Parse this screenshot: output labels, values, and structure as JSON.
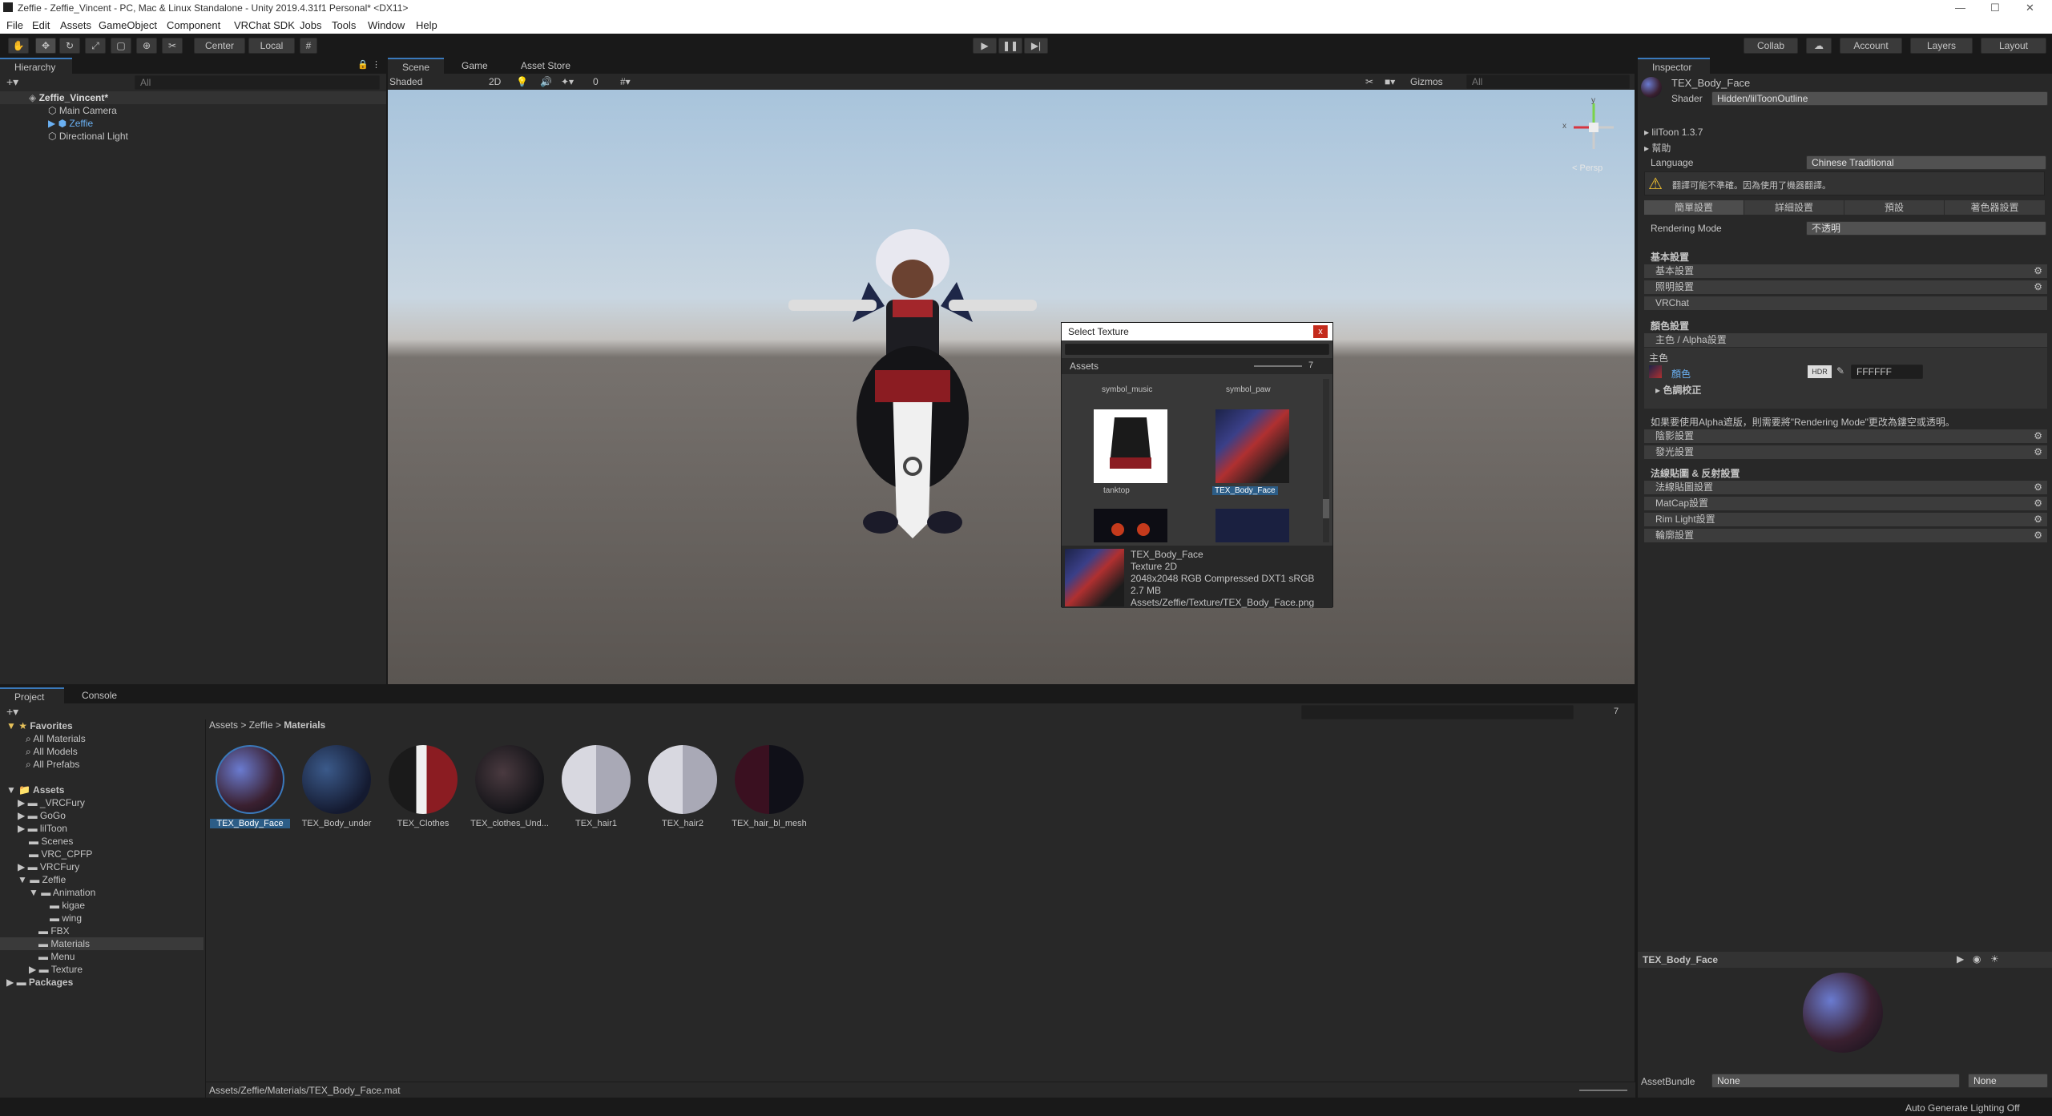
{
  "window": {
    "title": "Zeffie - Zeffie_Vincent - PC, Mac & Linux Standalone - Unity 2019.4.31f1 Personal* <DX11>"
  },
  "menu": [
    "File",
    "Edit",
    "Assets",
    "GameObject",
    "Component",
    "VRChat SDK",
    "Jobs",
    "Tools",
    "Window",
    "Help"
  ],
  "toolbar": {
    "pivot": "Center",
    "space": "Local",
    "collab": "Collab",
    "account": "Account",
    "layers": "Layers",
    "layout": "Layout"
  },
  "hierarchy": {
    "tab": "Hierarchy",
    "search_placeholder": "All",
    "scene": "Zeffie_Vincent*",
    "items": [
      "Main Camera",
      "Zeffie",
      "Directional Light"
    ]
  },
  "scene": {
    "tabs": [
      "Scene",
      "Game",
      "Asset Store"
    ],
    "shading": "Shaded",
    "mode2d": "2D",
    "hidden_count": "0",
    "gizmos": "Gizmos",
    "search_placeholder": "All",
    "persp": "< Persp",
    "axis_x": "x",
    "axis_y": "y"
  },
  "select_texture": {
    "title": "Select Texture",
    "close": "x",
    "tab": "Assets",
    "count": "7",
    "columns": [
      "symbol_music",
      "symbol_paw"
    ],
    "items": [
      "tanktop",
      "TEX_Body_Face"
    ],
    "info": {
      "name": "TEX_Body_Face",
      "type": "Texture 2D",
      "format": "2048x2048  RGB Compressed DXT1 sRGB",
      "size": "2.7 MB",
      "path": "Assets/Zeffie/Texture/TEX_Body_Face.png"
    }
  },
  "project": {
    "tabs": [
      "Project",
      "Console"
    ],
    "count": "7",
    "favorites_label": "Favorites",
    "favorites": [
      "All Materials",
      "All Models",
      "All Prefabs"
    ],
    "assets_label": "Assets",
    "assets": [
      "_VRCFury",
      "GoGo",
      "lilToon",
      "Scenes",
      "VRC_CPFP",
      "VRCFury",
      "Zeffie",
      "Animation",
      "kigae",
      "wing",
      "FBX",
      "Materials",
      "Menu",
      "Texture",
      "Packages"
    ],
    "breadcrumb": [
      "Assets",
      "Zeffie",
      "Materials"
    ],
    "materials": [
      "TEX_Body_Face",
      "TEX_Body_under",
      "TEX_Clothes",
      "TEX_clothes_Und...",
      "TEX_hair1",
      "TEX_hair2",
      "TEX_hair_bl_mesh"
    ],
    "footer_path": "Assets/Zeffie/Materials/TEX_Body_Face.mat"
  },
  "inspector": {
    "tab": "Inspector",
    "material": "TEX_Body_Face",
    "shader_label": "Shader",
    "shader": "Hidden/lilToonOutline",
    "version": "lilToon 1.3.7",
    "help": "幫助",
    "language_label": "Language",
    "language": "Chinese Traditional",
    "warning": "翻譯可能不準確。因為使用了機器翻譯。",
    "mode_tabs": [
      "簡單設置",
      "詳細設置",
      "預設",
      "著色器設置"
    ],
    "rendering_label": "Rendering Mode",
    "rendering": "不透明",
    "basic_header": "基本設置",
    "basic_sections": [
      "基本設置",
      "照明設置",
      "VRChat"
    ],
    "color_header": "顏色設置",
    "color_sections": [
      "主色 / Alpha設置"
    ],
    "main_color": "主色",
    "color_label": "顏色",
    "hdr": "HDR",
    "hex": "FFFFFF",
    "color_correction": "色調校正",
    "alpha_note": "如果要使用Alpha遮版，則需要將\"Rendering Mode\"更改為鏤空或透明。",
    "shadow_sections": [
      "陰影設置",
      "發光設置"
    ],
    "normal_header": "法線貼圖 & 反射設置",
    "normal_sections": [
      "法線貼圖設置",
      "MatCap設置",
      "Rim Light設置",
      "輪廓設置"
    ],
    "preview_name": "TEX_Body_Face",
    "assetbundle_label": "AssetBundle",
    "assetbundle": "None",
    "variant": "None"
  },
  "status": {
    "text": "Auto Generate Lighting Off"
  }
}
